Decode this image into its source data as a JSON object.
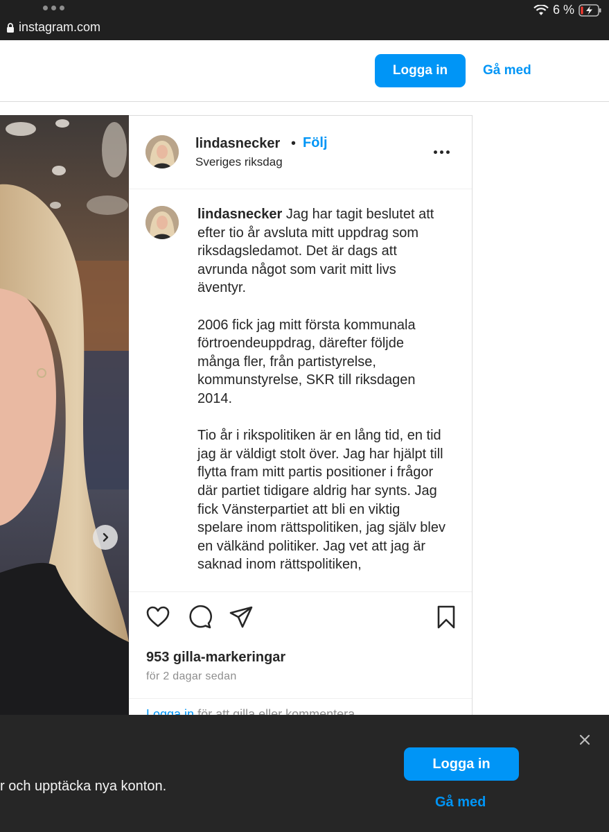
{
  "status_bar": {
    "battery_text": "6 %",
    "url": "instagram.com"
  },
  "header": {
    "login_label": "Logga in",
    "join_label": "Gå med"
  },
  "post": {
    "username": "lindasnecker",
    "separator": "•",
    "follow_label": "Följ",
    "location": "Sveriges riksdag",
    "caption_username": "lindasnecker",
    "caption_paragraphs": [
      "Jag har tagit beslutet att efter tio år avsluta mitt uppdrag som riksdagsledamot. Det är dags att avrunda något som varit mitt livs äventyr.",
      "2006 fick jag mitt första kommunala förtroendeuppdrag, därefter följde många fler, från partistyrelse, kommunstyrelse, SKR till riksdagen 2014.",
      "Tio år i rikspolitiken är en lång tid, en tid jag är väldigt stolt över. Jag har hjälpt till flytta fram mitt partis positioner i frågor där partiet tidigare aldrig har synts. Jag fick Vänsterpartiet att bli en viktig spelare inom rättspolitiken, jag själv blev en välkänd politiker. Jag vet att jag är saknad inom rättspolitiken,"
    ],
    "likes": "953 gilla-markeringar",
    "time_ago": "för 2 dagar sedan",
    "login_prompt_link": "Logga in",
    "login_prompt_text": " för att gilla eller kommentera."
  },
  "banner": {
    "text": "r och upptäcka nya konton.",
    "login_label": "Logga in",
    "join_label": "Gå med"
  },
  "icons": {
    "like": "heart-icon",
    "comment": "comment-icon",
    "share": "paper-plane-icon",
    "save": "bookmark-icon",
    "close": "close-icon",
    "next": "chevron-right-icon"
  },
  "colors": {
    "accent": "#0095f6",
    "status_bar_bg": "#202020",
    "banner_bg": "#262626"
  }
}
